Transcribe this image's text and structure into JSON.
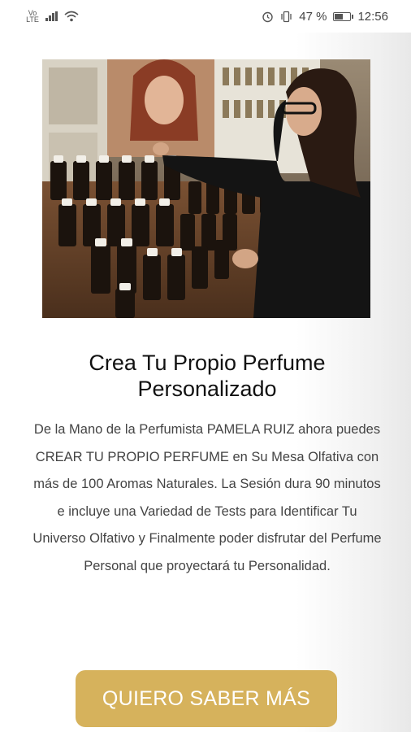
{
  "status_bar": {
    "network_type": "Vo LTE",
    "battery_percent": "47 %",
    "battery_level": 0.47,
    "time": "12:56",
    "icons": [
      "signal-icon",
      "wifi-icon",
      "alarm-icon",
      "vibrate-icon",
      "battery-icon"
    ]
  },
  "hero_image": {
    "icon": "perfumer-photo"
  },
  "main": {
    "title": "Crea Tu Propio Perfume Personalizado",
    "description": "De la Mano de la Perfumista PAMELA RUIZ ahora puedes CREAR TU PROPIO PERFUME en Su Mesa Olfativa con más de 100 Aromas Naturales. La Sesión dura 90 minutos e incluye una Variedad de Tests para Identificar Tu Universo Olfativo y Finalmente poder disfrutar del Perfume Personal que proyectará tu Personalidad.",
    "cta_label": "QUIERO SABER MÁS"
  },
  "colors": {
    "accent": "#d6b25c",
    "title": "#111111",
    "body": "#444444"
  }
}
